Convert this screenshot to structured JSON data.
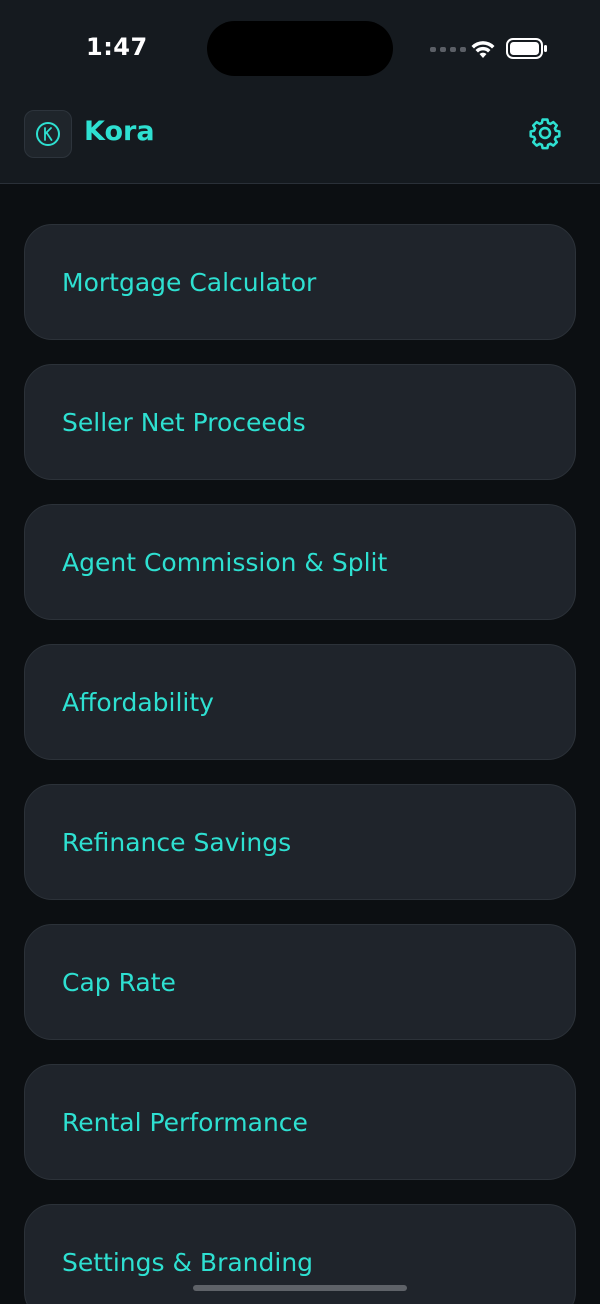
{
  "status_bar": {
    "time": "1:47"
  },
  "header": {
    "title": "Kora",
    "logo_icon": "kora-k-logo",
    "settings_icon": "gear-icon"
  },
  "menu": {
    "items": [
      {
        "label": "Mortgage Calculator"
      },
      {
        "label": "Seller Net Proceeds"
      },
      {
        "label": "Agent Commission & Split"
      },
      {
        "label": "Affordability"
      },
      {
        "label": "Refinance Savings"
      },
      {
        "label": "Cap Rate"
      },
      {
        "label": "Rental Performance"
      },
      {
        "label": "Settings & Branding"
      }
    ]
  },
  "colors": {
    "accent": "#2ee0d1",
    "background": "#0c0f12",
    "surface": "#1f242b",
    "header": "#151a1f"
  }
}
